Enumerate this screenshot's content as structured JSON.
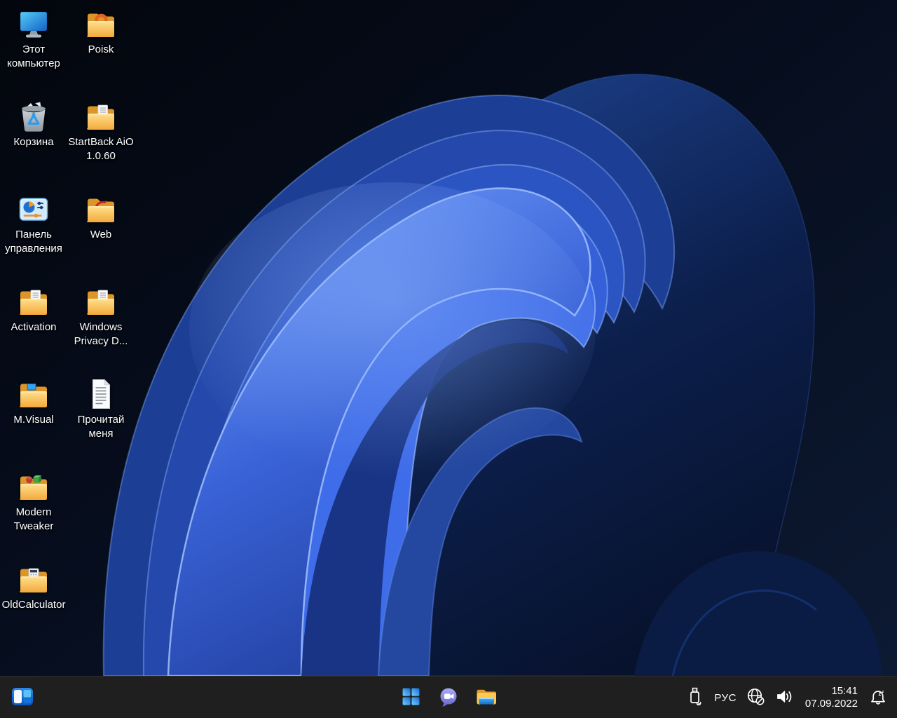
{
  "wallpaper": {
    "name": "windows-11-bloom-dark",
    "background_top": "#04070d",
    "background_bottom": "#0d1a33",
    "bloom_primary": "#3560d8",
    "bloom_highlight": "#7ea6f2"
  },
  "desktop": {
    "icons": [
      {
        "label": "Этот компьютер",
        "icon": "this-pc-icon"
      },
      {
        "label": "Poisk",
        "icon": "folder-search-icon"
      },
      {
        "label": "Корзина",
        "icon": "recycle-bin-icon"
      },
      {
        "label": "StartBack AiO 1.0.60",
        "icon": "folder-document-icon"
      },
      {
        "label": "Панель управления",
        "icon": "control-panel-icon"
      },
      {
        "label": "Web",
        "icon": "folder-web-icon"
      },
      {
        "label": "Activation",
        "icon": "folder-document-icon"
      },
      {
        "label": "Windows Privacy D...",
        "icon": "folder-document-icon"
      },
      {
        "label": "M.Visual",
        "icon": "folder-monitor-icon"
      },
      {
        "label": "Прочитай меня",
        "icon": "text-file-icon"
      },
      {
        "label": "Modern Tweaker",
        "icon": "folder-gems-icon"
      },
      {
        "label": "OldCalculator",
        "icon": "folder-calculator-icon"
      }
    ]
  },
  "taskbar": {
    "background_color": "#1f1f1f",
    "widgets_button": {
      "icon": "widgets-icon"
    },
    "center_buttons": [
      {
        "name": "start",
        "icon": "windows-start-icon"
      },
      {
        "name": "chat",
        "icon": "teams-chat-icon"
      },
      {
        "name": "file-explorer",
        "icon": "file-explorer-icon"
      }
    ],
    "tray": {
      "usb_icon": "usb-safely-remove-icon",
      "language": "РУС",
      "network_icon": "globe-no-internet-icon",
      "volume_icon": "speaker-volume-icon",
      "time": "15:41",
      "date": "07.09.2022",
      "notification_icon": "bell-dnd-icon"
    }
  }
}
